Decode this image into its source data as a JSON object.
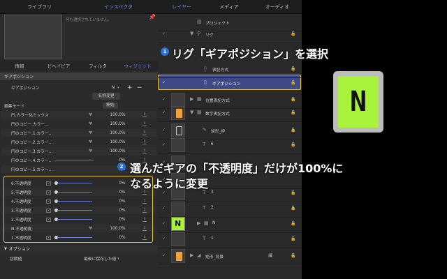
{
  "top_tabs": [
    "ライブラリ",
    "インスペクタ",
    "レイヤー",
    "メディア",
    "オーディオ"
  ],
  "preview_text": "何も選択されていません。",
  "sub_tabs": [
    "情報",
    "ビヘイビア",
    "フィルタ",
    "ウィジェット"
  ],
  "section_title": "ギアポジション",
  "gear_label": "ギアポジション",
  "gear_value": "N",
  "rename_button": "名称変更",
  "edit_mode": "編集モード",
  "start_button": "開始",
  "rows": [
    {
      "label": "円.カラー化ミックス",
      "value": "100.0",
      "unit": "%"
    },
    {
      "label": "円のコピー.カラー...",
      "value": "100.0",
      "unit": "%"
    },
    {
      "label": "円のコピー.1.カラー...",
      "value": "100.0",
      "unit": "%"
    },
    {
      "label": "円のコピー.2.カラー...",
      "value": "100.0",
      "unit": "%"
    },
    {
      "label": "円のコピー.3.カラー...",
      "value": "100.0",
      "unit": "%"
    },
    {
      "label": "円のコピー.4.カラー...",
      "value": "0",
      "unit": "%"
    },
    {
      "label": "円のコピー.5.カラー...",
      "value": "0",
      "unit": "%"
    },
    {
      "label": "6.不透明度",
      "value": "0",
      "unit": "%"
    },
    {
      "label": "5.不透明度",
      "value": "0",
      "unit": "%"
    },
    {
      "label": "4.不透明度",
      "value": "0",
      "unit": "%"
    },
    {
      "label": "3.不透明度",
      "value": "0",
      "unit": "%"
    },
    {
      "label": "2.不透明度",
      "value": "0",
      "unit": "%"
    },
    {
      "label": "N.不透明度",
      "value": "100.0",
      "unit": "%"
    },
    {
      "label": "1.不透明度",
      "value": "0",
      "unit": "%"
    }
  ],
  "options_header": "オプション",
  "initial_label": "初期値",
  "initial_value": "最後に保存した値",
  "layers": [
    {
      "name": "プロジェクト"
    },
    {
      "name": "リグ"
    },
    {
      "name": "表記方式"
    },
    {
      "name": "ギアポジション"
    },
    {
      "name": "位置表記方式"
    },
    {
      "name": "数字表記方式"
    },
    {
      "name": "矩形_枠"
    },
    {
      "name": "6"
    },
    {
      "name": "3"
    },
    {
      "name": "2"
    },
    {
      "name": "N"
    },
    {
      "name": "1"
    },
    {
      "name": "矩形_背景"
    }
  ],
  "annotation1": {
    "num": "1",
    "text": "リグ「ギアポジション」を選択"
  },
  "annotation2": {
    "num": "2",
    "line1": "選んだギアの「不透明度」だけが100%に",
    "line2": "なるように変更"
  },
  "lcd_text": "N",
  "colors": {
    "accent": "#6f86ff",
    "highlight": "#e8c53a",
    "badge": "#2a6fd6",
    "lcd": "#a8f23b"
  }
}
